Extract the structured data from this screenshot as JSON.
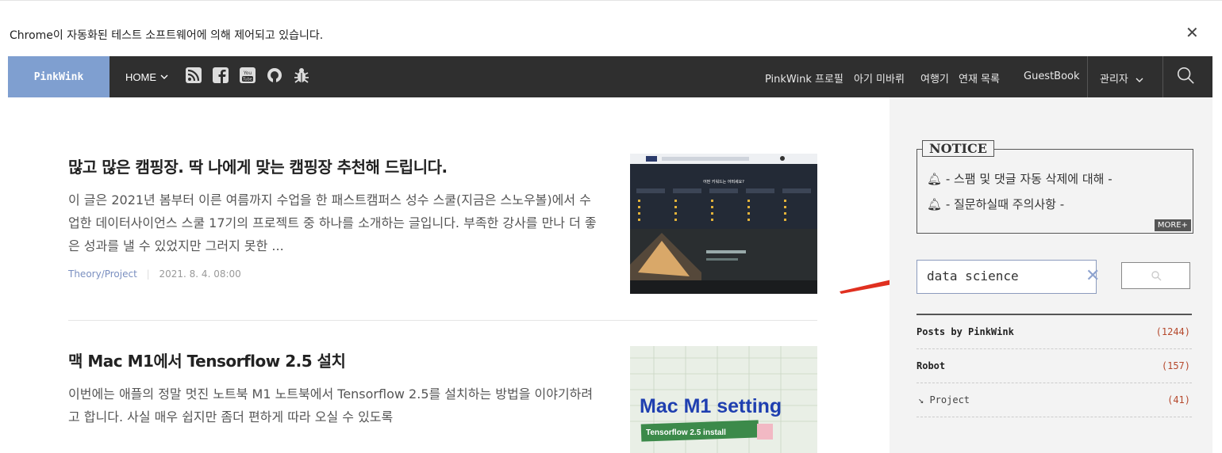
{
  "infobar": {
    "message": "Chrome이 자동화된 테스트 소프트웨어에 의해 제어되고 있습니다.",
    "close": "✕"
  },
  "nav": {
    "brand": "PinkWink",
    "home": "HOME",
    "icons": [
      "rss-icon",
      "facebook-icon",
      "youtube-icon",
      "github-icon",
      "bug-icon"
    ],
    "links": [
      "PinkWink 프로필",
      "아기 미바뤼",
      "여행기",
      "연재 목록",
      "GuestBook"
    ],
    "admin": "관리자"
  },
  "posts": [
    {
      "title": "많고 많은 캠핑장. 딱 나에게 맞는 캠핑장 추천해 드립니다.",
      "excerpt": "이 글은 2021년 봄부터 이른 여름까지 수업을 한 패스트캠퍼스 성수 스쿨(지금은 스노우볼)에서 수업한 데이터사이언스 스쿨 17기의 프로젝트 중 하나를 소개하는 글입니다. 부족한 강사를 만나 더 좋은 성과를 낼 수 있었지만 그러지 못한 ...",
      "category": "Theory/Project",
      "date": "2021. 8. 4. 08:00",
      "thumb_text": "어떤 키워드는 어떠세요?"
    },
    {
      "title": "맥 Mac M1에서 Tensorflow 2.5 설치",
      "excerpt": "이번에는 애플의 정말 멋진 노트북 M1 노트북에서 Tensorflow 2.5를 설치하는 방법을 이야기하려고 합니다. 사실 매우 쉽지만 좀더 편하게 따라 오실 수 있도록",
      "thumb_text": "Mac M1 setting",
      "thumb_text2": "Tensorflow 2.5 install"
    }
  ],
  "sidebar": {
    "notice": {
      "title": "NOTICE",
      "items": [
        "- 스팸 및 댓글 자동 삭제에 대해 -",
        "- 질문하실때 주의사항 -"
      ],
      "more": "MORE+"
    },
    "search": {
      "value": "data science",
      "clear": "✕"
    },
    "categories": [
      {
        "name": "Posts by PinkWink",
        "count": "(1244)"
      },
      {
        "name": "Robot",
        "count": "(157)"
      },
      {
        "name": "↘ Project",
        "count": "(41)"
      }
    ]
  },
  "colors": {
    "nav_bg": "#2f2f2f",
    "brand_bg": "#7f9fd0",
    "count": "#b5482c",
    "arrow": "#e03020"
  }
}
